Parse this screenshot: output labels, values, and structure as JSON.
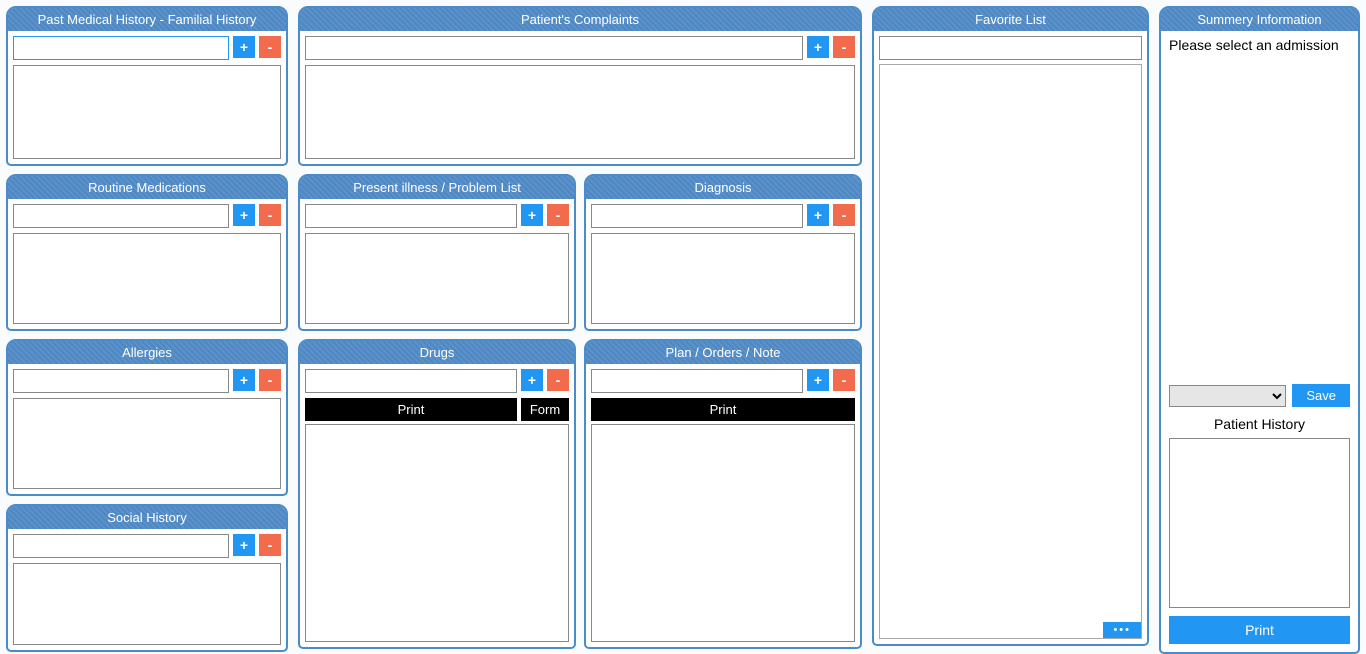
{
  "buttons": {
    "add": "+",
    "remove": "-",
    "print": "Print",
    "form": "Form",
    "save": "Save",
    "dots": "•••"
  },
  "panels": {
    "pmh": "Past Medical History - Familial History",
    "routine": "Routine Medications",
    "allergies": "Allergies",
    "social": "Social History",
    "complaints": "Patient's Complaints",
    "illness": "Present illness / Problem List",
    "diagnosis": "Diagnosis",
    "drugs": "Drugs",
    "plan": "Plan / Orders / Note",
    "favorite": "Favorite List",
    "summary": "Summery Information"
  },
  "summary": {
    "message": "Please select an admission",
    "history_label": "Patient History",
    "print": "Print"
  }
}
